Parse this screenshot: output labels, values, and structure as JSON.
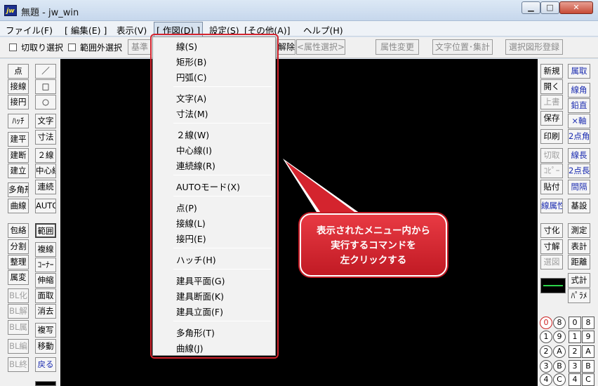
{
  "window": {
    "title": "無題 - jw_win",
    "icon_text": "jw",
    "min_label": "▁",
    "max_label": "□",
    "close_label": "✕"
  },
  "menubar": {
    "items": [
      "ファイル(F)",
      "[ 編集(E) ]",
      "表示(V)",
      "[ 作図(D) ]",
      "設定(S)",
      "[その他(A)]",
      "ヘルプ(H)"
    ]
  },
  "toolbar": {
    "check_window_select": "切取り選択",
    "check_outside_select": "範囲外選択",
    "btn_base": "基準",
    "btn_release": "解除",
    "btn_attr_select": "<属性選択>",
    "btn_attr_change": "属性変更",
    "btn_text_position": "文字位置･集計",
    "btn_register_shape": "選択図形登録"
  },
  "left_panel": {
    "col1": [
      "点",
      "接線",
      "接円",
      "ﾊｯﾁ",
      "建平",
      "建断",
      "建立",
      "多角形",
      "曲線",
      "包絡",
      "分割",
      "整理",
      "属変",
      "BL化",
      "BL解",
      "BL属",
      "BL編",
      "BL終"
    ],
    "col2": [
      "／",
      "□",
      "○",
      "文字",
      "寸法",
      "２線",
      "中心線",
      "連続",
      "AUTO",
      "範囲",
      "複線",
      "ｺｰﾅｰ",
      "伸縮",
      "面取",
      "消去",
      "複写",
      "移動",
      "戻る"
    ]
  },
  "right_panel": {
    "col1": [
      "新規",
      "開く",
      "上書",
      "保存",
      "印刷",
      "切取",
      "ｺﾋﾟｰ",
      "貼付",
      "線属性",
      "寸化",
      "寸解",
      "選図"
    ],
    "col2": [
      "線角",
      "鉛直",
      "×軸",
      "2点角",
      "線長",
      "2点長",
      "間隔",
      "基設",
      "測定",
      "表計",
      "距離",
      "式計",
      "ﾊﾟﾗﾒ"
    ],
    "top_item": "属取",
    "layers": [
      "0",
      "8",
      "1",
      "9",
      "2",
      "A",
      "3",
      "B",
      "4",
      "C"
    ],
    "groups": [
      "0",
      "8",
      "1",
      "9",
      "2",
      "A",
      "3",
      "B",
      "4",
      "C"
    ]
  },
  "dropdown": {
    "groups": [
      [
        "線(S)",
        "矩形(B)",
        "円弧(C)"
      ],
      [
        "文字(A)",
        "寸法(M)"
      ],
      [
        "２線(W)",
        "中心線(I)",
        "連続線(R)"
      ],
      [
        "AUTOモード(X)"
      ],
      [
        "点(P)",
        "接線(L)",
        "接円(E)"
      ],
      [
        "ハッチ(H)"
      ],
      [
        "建具平面(G)",
        "建具断面(K)",
        "建具立面(F)"
      ],
      [
        "多角形(T)",
        "曲線(J)"
      ]
    ]
  },
  "callout": {
    "lines": [
      "表示されたメニュー内から",
      "実行するコマンドを",
      "左クリックする"
    ]
  },
  "colors": {
    "callout": "#d4242e",
    "canvas": "#000000",
    "accent_blue": "#1a2bb0"
  }
}
